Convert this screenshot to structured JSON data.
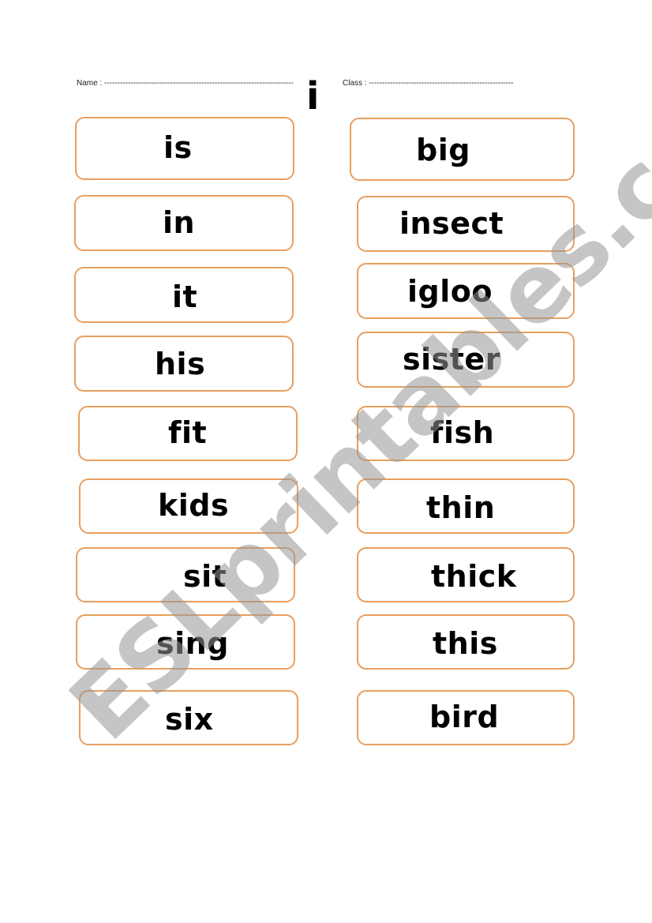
{
  "header": {
    "name_label": "Name : ------------------------------------------------------------------------",
    "class_label": "Class : -------------------------------------------------------",
    "letter": "i"
  },
  "left_column": [
    {
      "word": "is"
    },
    {
      "word": "in"
    },
    {
      "word": "it"
    },
    {
      "word": "his"
    },
    {
      "word": "fit"
    },
    {
      "word": "kids"
    },
    {
      "word": "sit"
    },
    {
      "word": "sing"
    },
    {
      "word": "six"
    }
  ],
  "right_column": [
    {
      "word": "big"
    },
    {
      "word": "insect"
    },
    {
      "word": "igloo"
    },
    {
      "word": "sister"
    },
    {
      "word": "fish"
    },
    {
      "word": "thin"
    },
    {
      "word": "thick"
    },
    {
      "word": "this"
    },
    {
      "word": "bird"
    }
  ],
  "watermark": "ESLprintables.com",
  "colors": {
    "card_border": "#e79f5f",
    "watermark": "#969696"
  }
}
